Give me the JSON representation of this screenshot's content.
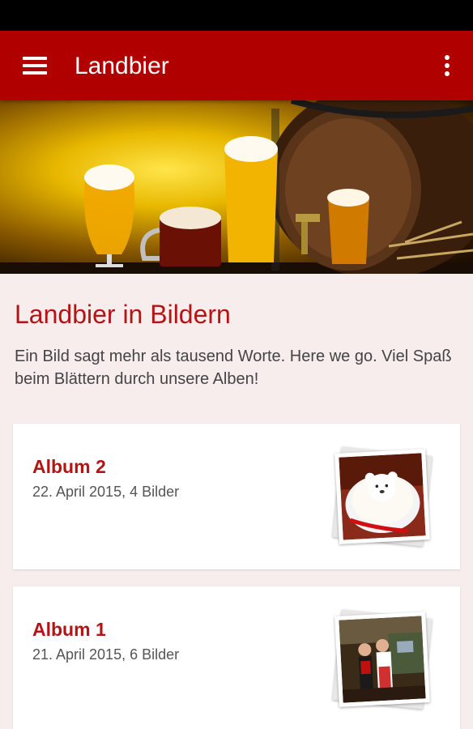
{
  "app_bar": {
    "title": "Landbier"
  },
  "section": {
    "title": "Landbier in Bildern",
    "description": "Ein Bild sagt mehr als tausend Worte. Here we go. Viel Spaß beim Blättern durch unsere Alben!"
  },
  "albums": [
    {
      "title": "Album 2",
      "meta": "22. April 2015, 4 Bilder",
      "thumbnail": "latte-art-bear-photo"
    },
    {
      "title": "Album 1",
      "meta": "21. April 2015, 6 Bilder",
      "thumbnail": "people-at-bar-photo"
    }
  ],
  "colors": {
    "primary": "#b10000",
    "accent_text": "#b51414",
    "background": "#f7eded"
  }
}
